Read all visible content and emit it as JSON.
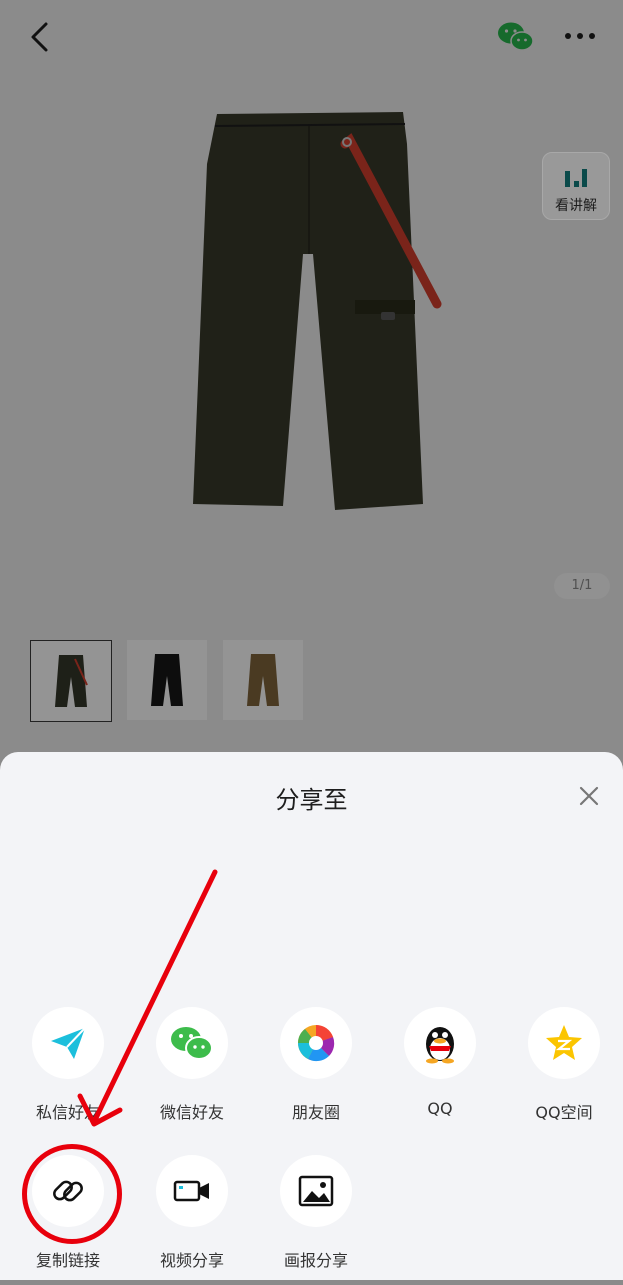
{
  "product": {
    "page_indicator": "1/1",
    "explain_label": "看讲解"
  },
  "share_sheet": {
    "title": "分享至",
    "options": [
      {
        "label": "私信好友",
        "icon": "paper-plane-icon"
      },
      {
        "label": "微信好友",
        "icon": "wechat-icon"
      },
      {
        "label": "朋友圈",
        "icon": "moments-aperture-icon"
      },
      {
        "label": "QQ",
        "icon": "qq-penguin-icon"
      },
      {
        "label": "QQ空间",
        "icon": "qzone-star-icon"
      },
      {
        "label": "复制链接",
        "icon": "link-icon"
      },
      {
        "label": "视频分享",
        "icon": "video-camera-icon"
      },
      {
        "label": "画报分享",
        "icon": "image-icon"
      }
    ]
  },
  "colors": {
    "annotation_red": "#e8000c",
    "sheet_bg": "#f3f4f7",
    "overlay_bg": "#8b8b8b"
  }
}
